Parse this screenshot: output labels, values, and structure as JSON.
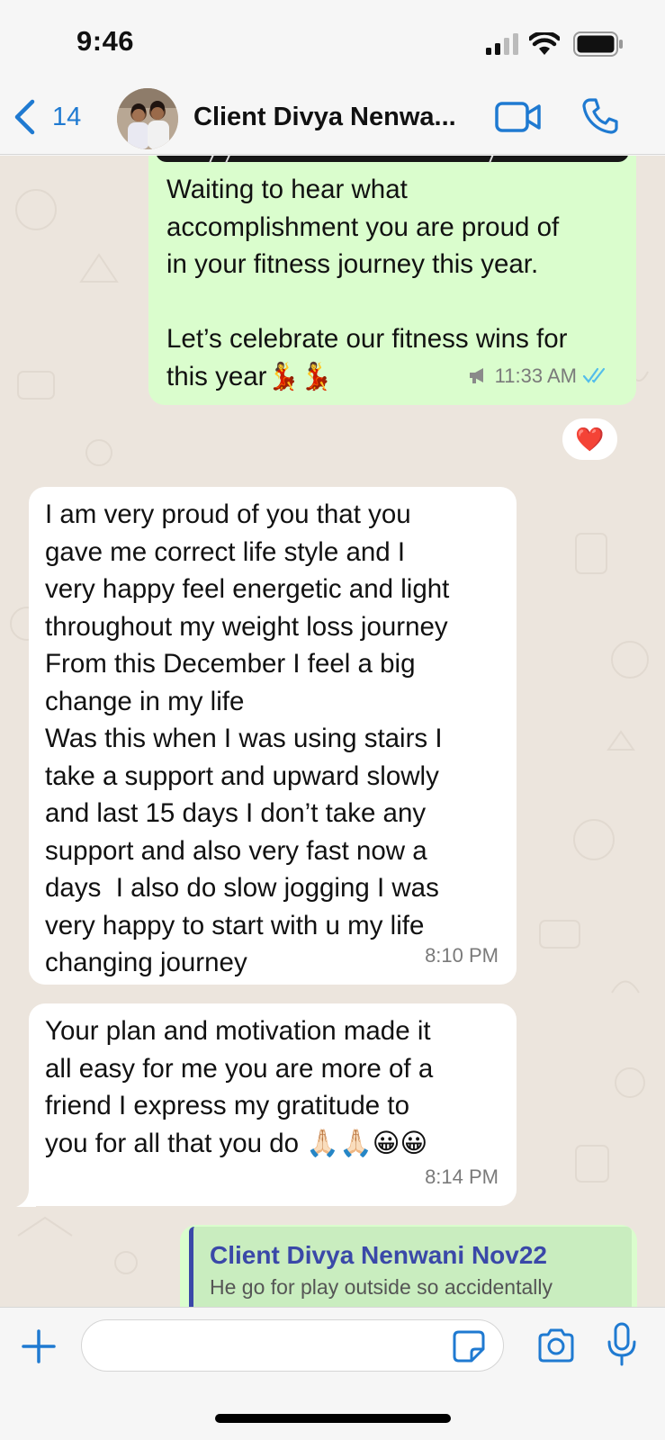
{
  "status_bar": {
    "time": "9:46"
  },
  "header": {
    "back_count": "14",
    "contact_name": "Client Divya Nenwa..."
  },
  "messages": [
    {
      "direction": "outgoing",
      "text": "Waiting to hear what\naccomplishment you are proud of\nin your fitness journey this year.\n\nLet’s celebrate our fitness wins for\nthis year💃💃",
      "time": "11:33 AM",
      "status": "read",
      "reaction": "❤️"
    },
    {
      "direction": "incoming",
      "text": "I am very proud of you that you\ngave me correct life style and I\nvery happy feel energetic and light\nthroughout my weight loss journey\nFrom this December I feel a big\nchange in my life\nWas this when I was using stairs I\ntake a support and upward slowly\nand last 15 days I don’t take any\nsupport and also very fast now a\ndays  I also do slow jogging I was\nvery happy to start with u my life\nchanging journey",
      "time": "8:10 PM"
    },
    {
      "direction": "incoming",
      "text": "Your plan and motivation made it\nall easy for me you are more of a\nfriend I express my gratitude to\nyou for all that you do 🙏🏻🙏🏻😀😀",
      "time": "8:14 PM"
    },
    {
      "direction": "outgoing",
      "quote": {
        "author": "Client Divya Nenwani Nov22",
        "text": "He go for play outside so accidentally"
      }
    }
  ],
  "input": {
    "placeholder": ""
  },
  "colors": {
    "accent": "#1f7ad1",
    "outgoing_bubble": "#dafdcd",
    "incoming_bubble": "#ffffff",
    "chat_background": "#ece5dd",
    "read_ticks": "#53bdeb",
    "quote_bar": "#3a48a8"
  },
  "icons": [
    "back-chevron-icon",
    "video-camera-icon",
    "phone-icon",
    "plus-icon",
    "sticker-icon",
    "camera-icon",
    "microphone-icon",
    "megaphone-icon",
    "double-check-icon",
    "signal-icon",
    "wifi-icon",
    "battery-icon"
  ]
}
